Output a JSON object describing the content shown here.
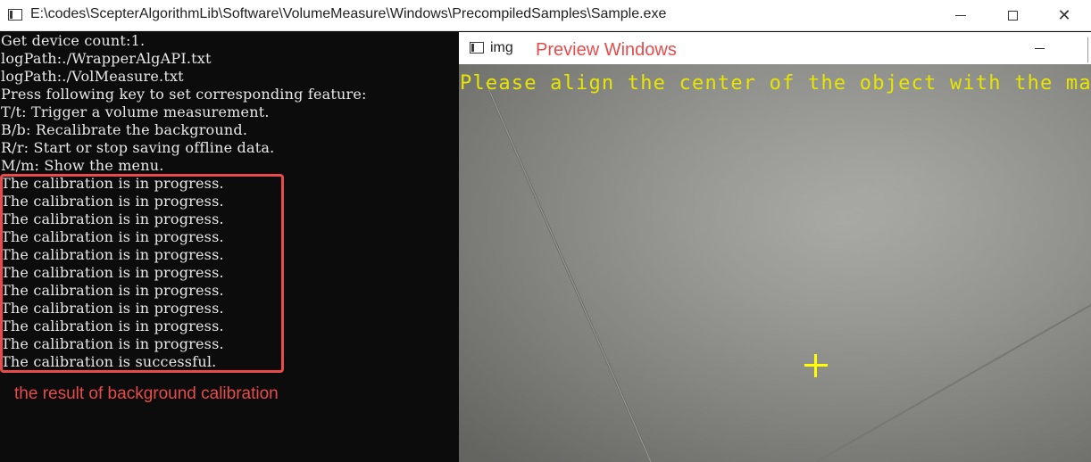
{
  "console_window": {
    "title": "E:\\codes\\ScepterAlgorithmLib\\Software\\VolumeMeasure\\Windows\\PrecompiledSamples\\Sample.exe",
    "controls": {
      "minimize": "minimize-icon",
      "maximize": "maximize-icon",
      "close": "✕"
    }
  },
  "console": {
    "lines": [
      "Get device count:1.",
      "logPath:./WrapperAlgAPI.txt",
      "logPath:./VolMeasure.txt",
      "Press following key to set corresponding feature:",
      "T/t: Trigger a volume measurement.",
      "B/b: Recalibrate the background.",
      "R/r: Start or stop saving offline data.",
      "M/m: Show the menu.",
      "The calibration is in progress.",
      "The calibration is in progress.",
      "The calibration is in progress.",
      "The calibration is in progress.",
      "The calibration is in progress.",
      "The calibration is in progress.",
      "The calibration is in progress.",
      "The calibration is in progress.",
      "The calibration is in progress.",
      "The calibration is in progress.",
      "The calibration is successful."
    ],
    "annotation": "the result of background calibration"
  },
  "preview_window": {
    "title": "img",
    "annotation": "Preview Windows",
    "hint": "Please align the center of the object with the mark point.",
    "colors": {
      "hint": "#e6e600",
      "mark": "#ffff00",
      "annotation": "#e74b4b"
    }
  }
}
